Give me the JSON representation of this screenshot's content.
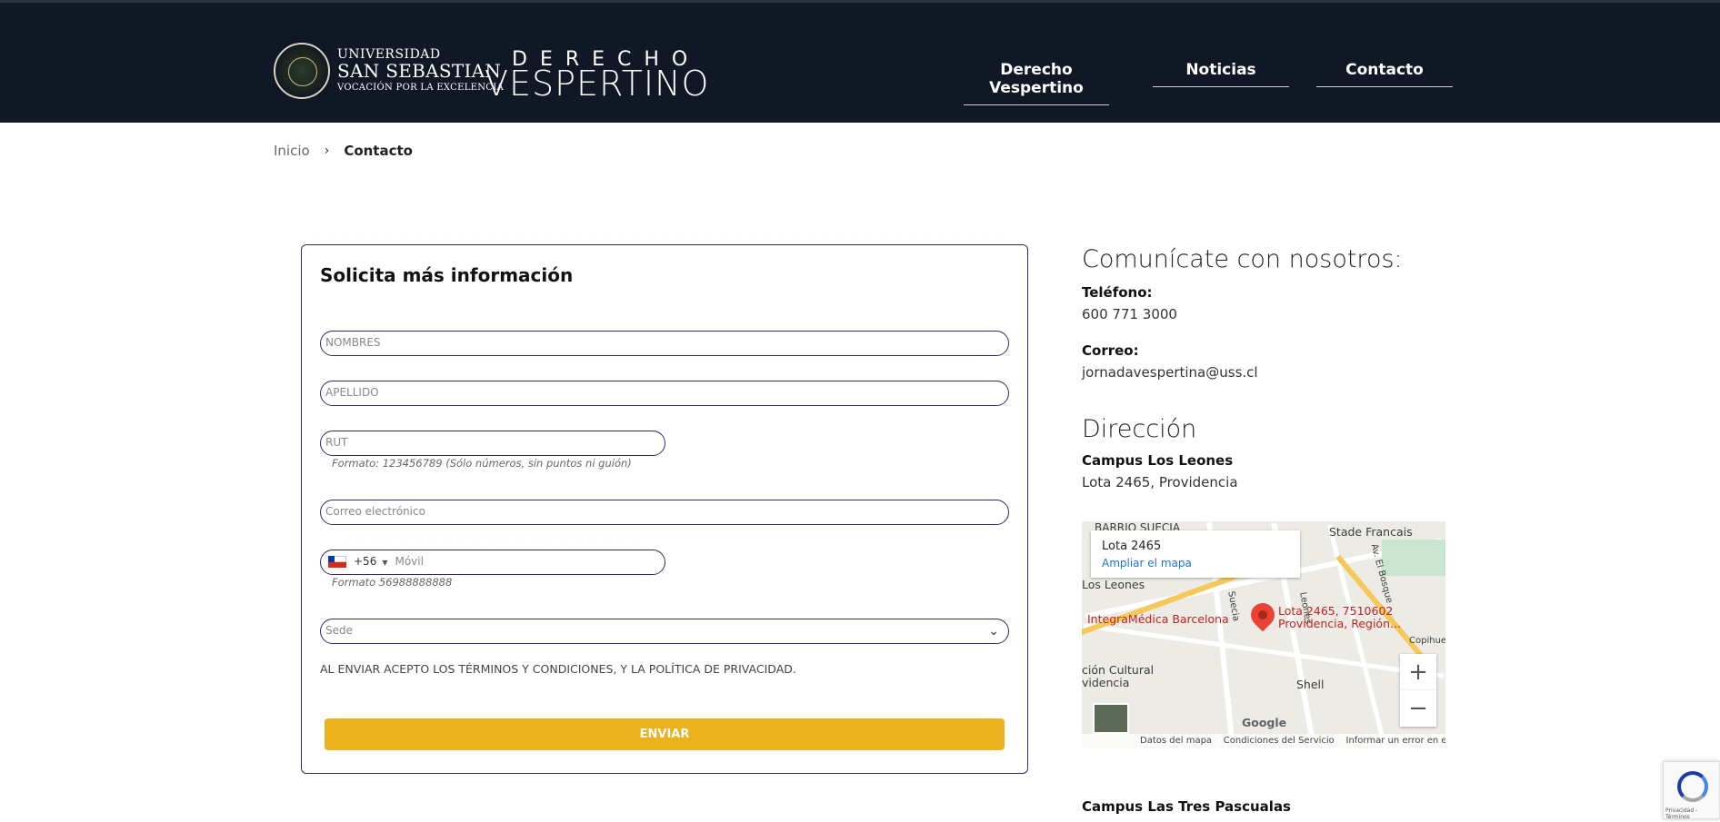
{
  "header": {
    "uss_line1": "UNIVERSIDAD",
    "uss_line2": "SAN SEBASTIAN",
    "uss_line3": "VOCACIÓN POR LA EXCELENCIA",
    "program_top": "DERECHO",
    "program_bottom": "VESPERTINO",
    "nav": [
      {
        "label": "Derecho Vespertino"
      },
      {
        "label": "Noticias"
      },
      {
        "label": "Contacto"
      }
    ]
  },
  "breadcrumb": {
    "home": "Inicio",
    "separator": "›",
    "current": "Contacto"
  },
  "form": {
    "title": "Solicita más información",
    "nombres_placeholder": "NOMBRES",
    "apellido_placeholder": "APELLIDO",
    "rut_placeholder": "RUT",
    "rut_hint": "Formato: 123456789 (Sólo números, sin puntos ni guión)",
    "email_placeholder": "Correo electrónico",
    "phone_code": "+56",
    "phone_placeholder": "Móvil",
    "phone_hint": "Formato 56988888888",
    "sede_placeholder": "Sede",
    "terms": "AL ENVIAR ACEPTO LOS TÉRMINOS Y CONDICIONES, Y LA POLÍTICA DE PRIVACIDAD.",
    "submit_label": "ENVIAR",
    "submit_color": "#eeb11e"
  },
  "contact": {
    "heading": "Comunícate con nosotros:",
    "phone_label": "Teléfono:",
    "phone_value": "600 771 3000",
    "email_label": "Correo:",
    "email_value": "jornadavespertina@uss.cl",
    "address_heading": "Dirección",
    "campus1_name": "Campus Los Leones",
    "campus1_address": "Lota 2465, Providencia",
    "campus2_name": "Campus Las Tres Pascualas"
  },
  "map": {
    "info_title": "Lota 2465",
    "info_link": "Ampliar el mapa",
    "labels": {
      "barrio": "BARRIO SUECIA",
      "stade": "Stade Francais",
      "los_leones": "Los Leones",
      "integramedica": "IntegraMédica Barcelona",
      "pin_line1": "Lota 2465, 7510602",
      "pin_line2": "Providencia, Región...",
      "cultural1": "ción Cultural",
      "cultural2": "videncia",
      "shell": "Shell",
      "suecia": "Suecia",
      "leones_st": "Leones",
      "el_bosque": "Av. El Bosque",
      "copihue": "Copihue",
      "google": "Google"
    },
    "zoom_in": "+",
    "zoom_out": "−",
    "footer": [
      "Datos del mapa",
      "Condiciones del Servicio",
      "Informar un error en el mapa"
    ]
  },
  "recaptcha": {
    "text": "Privacidad - Términos"
  }
}
